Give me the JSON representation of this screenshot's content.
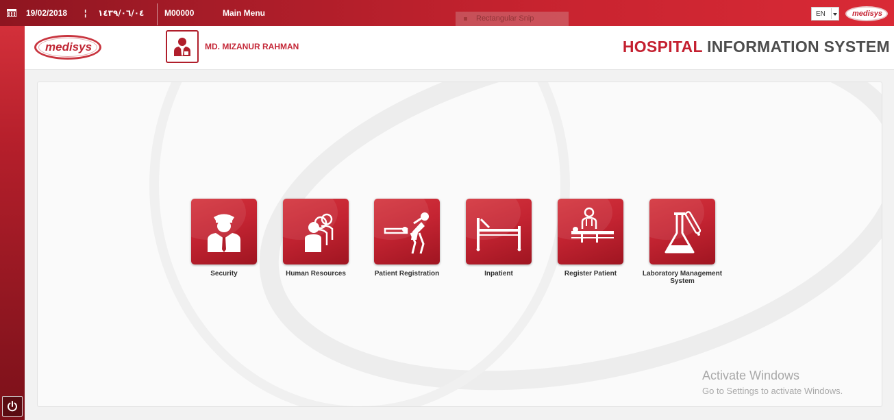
{
  "topbar": {
    "date_gregorian": "19/02/2018",
    "separator": "¦",
    "date_hijri": "١٤٣٩/٠٦/٠٤",
    "screen_code": "M00000",
    "screen_name": "Main Menu",
    "snip_overlay": "Rectangular Snip",
    "language": "EN",
    "logo_text": "medisys"
  },
  "header": {
    "logo_text": "medisys",
    "user_name": "MD. MIZANUR RAHMAN",
    "title_accent": "HOSPITAL",
    "title_rest": " INFORMATION SYSTEM"
  },
  "modules": [
    {
      "label": "Security",
      "icon": "security-guard-icon"
    },
    {
      "label": "Human Resources",
      "icon": "people-group-icon"
    },
    {
      "label": "Patient Registration",
      "icon": "wheelchair-patient-icon"
    },
    {
      "label": "Inpatient",
      "icon": "hospital-bed-icon"
    },
    {
      "label": "Register Patient",
      "icon": "doctor-patient-icon"
    },
    {
      "label": "Laboratory Management System",
      "icon": "lab-flask-icon"
    }
  ],
  "watermark": {
    "line1": "Activate Windows",
    "line2": "Go to Settings to activate Windows."
  },
  "colors": {
    "brand_red": "#c42030",
    "dark_red": "#8e1520",
    "title_gray": "#4d4d4d"
  }
}
